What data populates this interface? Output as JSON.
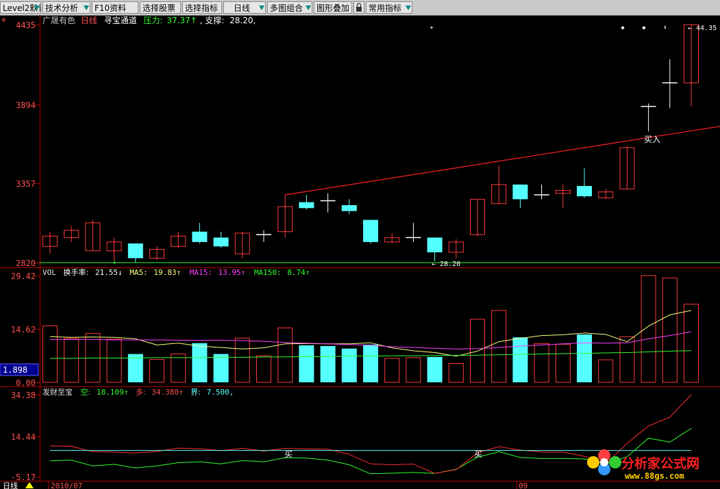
{
  "toolbar": {
    "items": [
      {
        "label": "Level2默认"
      },
      {
        "label": "技术分析"
      },
      {
        "label": "F10资料"
      },
      {
        "label": "选择股票"
      },
      {
        "label": "选择指标"
      },
      {
        "label": "日线"
      },
      {
        "label": "多图组合"
      },
      {
        "label": "图形叠加"
      },
      {
        "label": "常用指标"
      }
    ]
  },
  "main_chart": {
    "stock_name": "广晟有色",
    "period": "日线",
    "indicator_name": "寻宝通道",
    "pressure_label": "压力:",
    "pressure_value": "37.37↑",
    "support_label": ", 支撑:",
    "support_value": "28.20,",
    "y_labels": [
      "4435",
      "3894",
      "3357",
      "2820"
    ],
    "high_label": "44.35",
    "low_label": "28.20",
    "buy_label": "买入",
    "colors": {
      "up": "#ff3a3a",
      "down": "#54ffff",
      "cross": "#ffffff"
    }
  },
  "volume_chart": {
    "title": "VOL",
    "metric": "换手率:",
    "metric_value": "21.55↓",
    "ma5_label": "MA5:",
    "ma5_value": "19.83↑",
    "ma15_label": "MA15:",
    "ma15_value": "13.95↑",
    "ma150_label": "MA150:",
    "ma150_value": "8.74↑",
    "y_labels": [
      "29.42",
      "14.62",
      "0.00"
    ],
    "highlight_value": "1.898",
    "colors": {
      "ma5": "#ffff80",
      "ma15": "#ff40ff",
      "ma150": "#30ff30"
    }
  },
  "indicator_chart": {
    "title": "发财至宝",
    "kong_label": "空:",
    "kong_value": "18.109↑",
    "duo_label": "多:",
    "duo_value": "34.380↑",
    "jie_label": "界:",
    "jie_value": "7.500,",
    "y_labels": [
      "34.38",
      "14.44",
      "-5.17"
    ],
    "buy_marks": [
      "买",
      "买"
    ]
  },
  "bottom_bar": {
    "period": "日线",
    "date_start": "2010/07",
    "date_month": "09"
  },
  "watermark": {
    "brand": "分析家公式网",
    "url": "www.88gs.com"
  },
  "chart_data": [
    {
      "type": "candlestick",
      "title": "广晟有色 日线 寻宝通道",
      "ylim": [
        28.2,
        44.35
      ],
      "y_ticks": [
        44.35,
        38.94,
        33.57,
        28.2
      ],
      "candles": [
        {
          "o": 29.3,
          "h": 30.3,
          "l": 28.8,
          "c": 30.0
        },
        {
          "o": 29.9,
          "h": 30.7,
          "l": 29.6,
          "c": 30.4
        },
        {
          "o": 29.0,
          "h": 31.1,
          "l": 29.0,
          "c": 30.9
        },
        {
          "o": 29.0,
          "h": 29.9,
          "l": 28.3,
          "c": 29.6
        },
        {
          "o": 29.5,
          "h": 29.5,
          "l": 28.2,
          "c": 28.5
        },
        {
          "o": 28.5,
          "h": 29.3,
          "l": 28.4,
          "c": 29.1
        },
        {
          "o": 29.3,
          "h": 30.3,
          "l": 29.2,
          "c": 30.0
        },
        {
          "o": 30.3,
          "h": 30.9,
          "l": 29.5,
          "c": 29.6
        },
        {
          "o": 29.9,
          "h": 30.3,
          "l": 29.2,
          "c": 29.3
        },
        {
          "o": 28.8,
          "h": 30.3,
          "l": 28.5,
          "c": 30.2
        },
        {
          "o": 30.0,
          "h": 30.4,
          "l": 29.6,
          "c": 30.1
        },
        {
          "o": 30.3,
          "h": 32.8,
          "l": 29.9,
          "c": 32.0
        },
        {
          "o": 32.3,
          "h": 32.8,
          "l": 31.8,
          "c": 31.9
        },
        {
          "o": 32.4,
          "h": 32.9,
          "l": 31.6,
          "c": 32.3
        },
        {
          "o": 32.1,
          "h": 32.5,
          "l": 31.5,
          "c": 31.7
        },
        {
          "o": 31.1,
          "h": 31.1,
          "l": 29.5,
          "c": 29.6
        },
        {
          "o": 29.6,
          "h": 30.2,
          "l": 29.5,
          "c": 29.9
        },
        {
          "o": 29.8,
          "h": 30.9,
          "l": 29.6,
          "c": 29.9
        },
        {
          "o": 29.9,
          "h": 29.9,
          "l": 28.3,
          "c": 28.9
        },
        {
          "o": 28.9,
          "h": 29.8,
          "l": 28.5,
          "c": 29.6
        },
        {
          "o": 30.1,
          "h": 32.5,
          "l": 30.0,
          "c": 32.5
        },
        {
          "o": 32.2,
          "h": 34.8,
          "l": 32.2,
          "c": 33.5
        },
        {
          "o": 33.5,
          "h": 33.5,
          "l": 31.9,
          "c": 32.5
        },
        {
          "o": 32.8,
          "h": 33.5,
          "l": 32.5,
          "c": 32.8
        },
        {
          "o": 32.9,
          "h": 33.5,
          "l": 31.9,
          "c": 33.1
        },
        {
          "o": 33.4,
          "h": 34.6,
          "l": 32.6,
          "c": 32.7
        },
        {
          "o": 32.6,
          "h": 33.2,
          "l": 32.5,
          "c": 33.0
        },
        {
          "o": 33.2,
          "h": 36.1,
          "l": 33.2,
          "c": 36.0
        },
        {
          "o": 38.8,
          "h": 39.0,
          "l": 37.1,
          "c": 38.8
        },
        {
          "o": 40.4,
          "h": 42.0,
          "l": 38.7,
          "c": 40.4
        },
        {
          "o": 40.4,
          "h": 44.35,
          "l": 38.8,
          "c": 44.35
        }
      ],
      "pressure_line": {
        "x_start": 11,
        "y_start": 32.8,
        "x_end": 31,
        "y_end": 37.37
      },
      "support_line": 28.2
    },
    {
      "type": "bar",
      "title": "VOL 换手率",
      "ylim": [
        0.0,
        29.42
      ],
      "values": [
        15.6,
        12.1,
        13.5,
        11.9,
        7.8,
        6.3,
        7.8,
        10.8,
        7.8,
        12.2,
        7.3,
        15.0,
        10.2,
        10.0,
        9.3,
        10.4,
        6.6,
        6.8,
        7.0,
        5.2,
        17.4,
        19.8,
        12.4,
        10.7,
        10.5,
        13.2,
        6.2,
        12.6,
        29.42,
        28.8,
        21.55
      ],
      "series": [
        {
          "name": "MA5",
          "values": [
            12.6,
            12.4,
            12.5,
            12.4,
            12.0,
            10.3,
            10.8,
            10.0,
            9.6,
            9.2,
            9.5,
            10.6,
            10.7,
            10.6,
            10.6,
            10.9,
            9.5,
            8.7,
            8.2,
            7.2,
            8.6,
            11.2,
            12.1,
            12.9,
            13.1,
            13.6,
            13.2,
            11.2,
            15.5,
            18.6,
            19.83
          ]
        },
        {
          "name": "MA15",
          "values": [
            11.8,
            11.8,
            11.8,
            11.7,
            11.7,
            11.7,
            11.6,
            11.6,
            11.6,
            11.5,
            11.3,
            11.0,
            10.8,
            10.6,
            10.4,
            10.2,
            9.8,
            9.6,
            9.4,
            9.2,
            9.3,
            9.6,
            10.0,
            10.3,
            10.6,
            10.9,
            10.8,
            10.9,
            12.0,
            12.9,
            13.95
          ]
        },
        {
          "name": "MA150",
          "values": [
            6.6,
            6.6,
            6.7,
            6.7,
            6.7,
            6.8,
            6.8,
            6.8,
            6.9,
            6.9,
            7.0,
            7.0,
            7.1,
            7.1,
            7.2,
            7.2,
            7.3,
            7.3,
            7.4,
            7.4,
            7.5,
            7.6,
            7.7,
            7.8,
            7.9,
            8.0,
            8.1,
            8.2,
            8.4,
            8.6,
            8.74
          ]
        }
      ]
    },
    {
      "type": "line",
      "title": "发财至宝",
      "ylim": [
        -5.17,
        34.38
      ],
      "series": [
        {
          "name": "空",
          "values": [
            2.5,
            2.8,
            0.0,
            0.8,
            -1.0,
            0.0,
            1.6,
            2.0,
            1.0,
            2.6,
            2.0,
            4.0,
            3.8,
            2.8,
            0.6,
            -3.8,
            -3.5,
            -3.1,
            -3.6,
            -1.6,
            4.2,
            6.9,
            4.1,
            3.6,
            3.6,
            3.4,
            1.0,
            4.5,
            13.4,
            11.5,
            18.109
          ]
        },
        {
          "name": "多",
          "values": [
            9.7,
            9.5,
            6.9,
            6.7,
            6.3,
            7.0,
            8.6,
            8.3,
            7.4,
            8.5,
            7.2,
            8.5,
            8.2,
            8.1,
            5.6,
            1.0,
            0.6,
            0.9,
            -3.6,
            -1.8,
            6.3,
            9.3,
            7.7,
            6.7,
            6.7,
            4.7,
            1.0,
            10.9,
            19.3,
            23.5,
            34.38
          ]
        },
        {
          "name": "界",
          "values": [
            7.5,
            7.5,
            7.5,
            7.5,
            7.5,
            7.5,
            7.5,
            7.5,
            7.5,
            7.5,
            7.5,
            7.5,
            7.5,
            7.5,
            7.5,
            7.5,
            7.5,
            7.5,
            7.5,
            7.5,
            7.5,
            7.5,
            7.5,
            7.5,
            7.5,
            7.5,
            7.5,
            7.5,
            7.5,
            7.5,
            7.5
          ]
        }
      ]
    }
  ]
}
